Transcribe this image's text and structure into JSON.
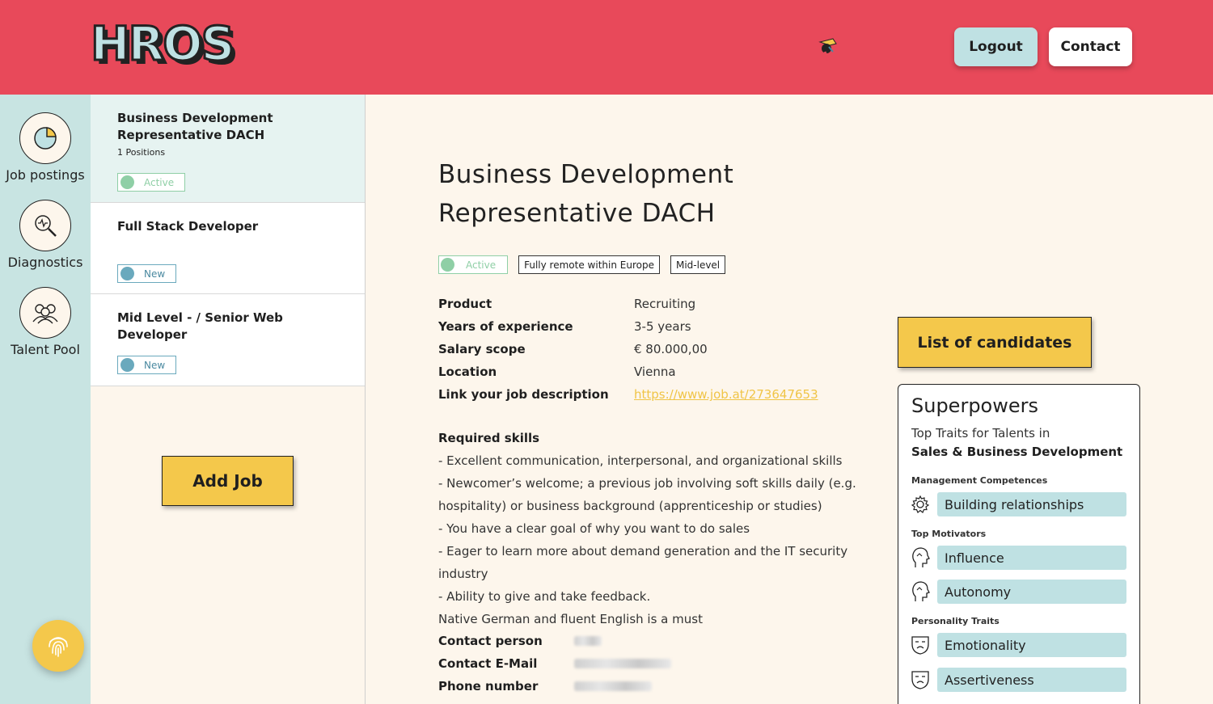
{
  "header": {
    "logo": "HROS",
    "logout_label": "Logout",
    "contact_label": "Contact"
  },
  "rail": {
    "items": [
      {
        "label": "Job postings",
        "icon": "pie-chart-icon"
      },
      {
        "label": "Diagnostics",
        "icon": "magnifier-icon"
      },
      {
        "label": "Talent Pool",
        "icon": "people-icon"
      }
    ],
    "fingerprint_icon": "fingerprint-icon"
  },
  "jobs": [
    {
      "title": "Business Development Representative DACH",
      "positions": "1 Positions",
      "status": "Active"
    },
    {
      "title": "Full Stack Developer",
      "status": "New"
    },
    {
      "title": "Mid Level - / Senior Web Developer",
      "status": "New"
    }
  ],
  "add_job_label": "Add Job",
  "main": {
    "title_line1": "Business Development",
    "title_line2": "Representative DACH",
    "status": "Active",
    "tag_remote": "Fully remote within Europe",
    "tag_level": "Mid-level",
    "details": [
      {
        "label": "Product",
        "value": "Recruiting"
      },
      {
        "label": "Years of experience",
        "value": "3-5 years"
      },
      {
        "label": "Salary scope",
        "value": "€ 80.000,00"
      },
      {
        "label": "Location",
        "value": "Vienna"
      },
      {
        "label": "Link your job description",
        "value": "https://www.job.at/273647653"
      }
    ],
    "skills_heading": "Required skills",
    "skills": [
      "- Excellent communication, interpersonal, and organizational skills",
      "- Newcomer’s welcome; a previous job involving soft skills daily (e.g. hospitality) or business background (apprenticeship or studies)",
      "- You have a clear goal of why you want to do sales",
      "- Eager to learn more about demand generation and the IT security industry",
      "- Ability to give and take feedback.",
      "Native German and fluent English is a must"
    ],
    "contact_person_label": "Contact person",
    "contact_email_label": "Contact E-Mail",
    "phone_label": "Phone number"
  },
  "candidates_label": "List of candidates",
  "superpowers": {
    "title": "Superpowers",
    "subtitle": "Top Traits for Talents in",
    "subtitle_bold": "Sales & Business Development",
    "management_label": "Management Competences",
    "motivators_label": "Top Motivators",
    "personality_label": "Personality Traits",
    "traits": [
      {
        "label": "Building relationships",
        "icon": "gear-icon"
      },
      {
        "label": "Influence",
        "icon": "head-icon"
      },
      {
        "label": "Autonomy",
        "icon": "head-icon"
      },
      {
        "label": "Emotionality",
        "icon": "mask-icon"
      },
      {
        "label": "Assertiveness",
        "icon": "mask-icon"
      }
    ]
  },
  "colors": {
    "header": "#e8495a",
    "rail": "#c8e4e2",
    "accent": "#f4c84b",
    "pill": "#bfe1e3",
    "active": "#8fcfa6"
  }
}
